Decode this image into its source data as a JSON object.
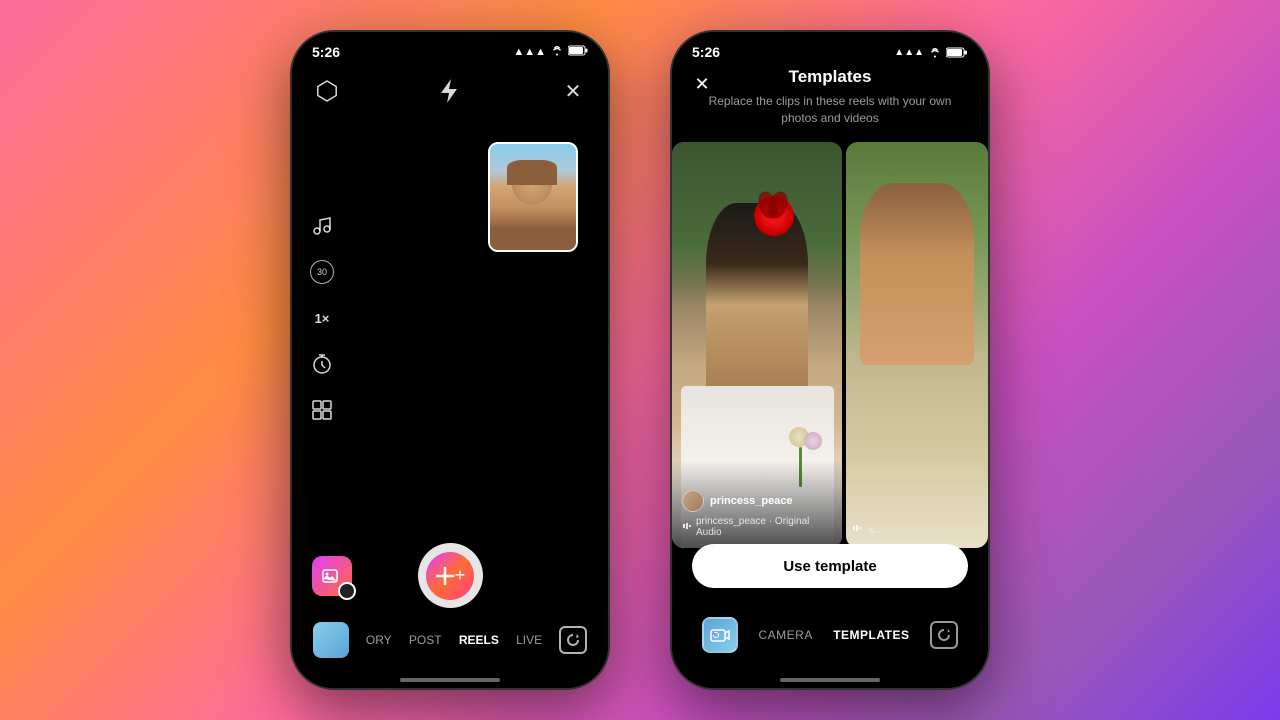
{
  "background": {
    "gradient": "linear-gradient(135deg, #ff6b9d, #ff8c42, #c850c0, #7c3aed)"
  },
  "phone1": {
    "status_bar": {
      "time": "5:26",
      "signal_icon": "📶",
      "wifi_icon": "WiFi",
      "battery_icon": "🔋"
    },
    "top_controls": {
      "filter_icon": "hexagon",
      "flash_icon": "bolt",
      "close_icon": "✕"
    },
    "left_controls": {
      "music_icon": "♫",
      "timer_label": "30",
      "speed_label": "1×",
      "countdown_icon": "⏱",
      "layout_icon": "⊞"
    },
    "selfie_preview": {
      "alt": "selfie thumbnail"
    },
    "bottom_nav": {
      "items": [
        {
          "label": "ORY",
          "active": false
        },
        {
          "label": "POST",
          "active": false
        },
        {
          "label": "REELS",
          "active": true
        },
        {
          "label": "LIVE",
          "active": false
        }
      ]
    },
    "shutter_button": {
      "label": "capture"
    }
  },
  "phone2": {
    "status_bar": {
      "time": "5:26"
    },
    "header": {
      "close_icon": "✕",
      "title": "Templates",
      "subtitle": "Replace the clips in these reels with your own photos and videos"
    },
    "template_card_main": {
      "username": "princess_peace",
      "audio_icon": "♫",
      "audio_label": "princess_peace · Original Audio"
    },
    "use_template_button": {
      "label": "Use template"
    },
    "bottom_nav": {
      "camera_label": "CAMERA",
      "templates_label": "TEMPLATES"
    }
  }
}
